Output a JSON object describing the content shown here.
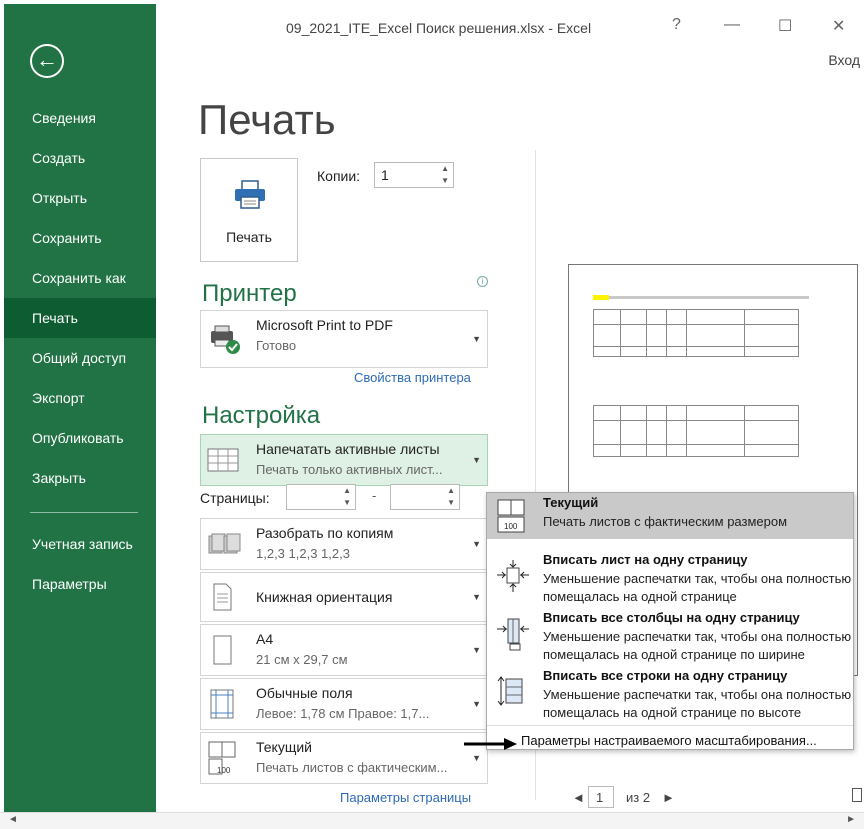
{
  "window": {
    "title": "09_2021_ITE_Excel Поиск решения.xlsx - Excel",
    "help": "?",
    "minimize": "—",
    "maximize": "☐",
    "close": "✕",
    "sign_in": "Вход"
  },
  "nav": {
    "back_icon": "←",
    "items": [
      {
        "label": "Сведения"
      },
      {
        "label": "Создать"
      },
      {
        "label": "Открыть"
      },
      {
        "label": "Сохранить"
      },
      {
        "label": "Сохранить как"
      },
      {
        "label": "Печать",
        "active": true
      },
      {
        "label": "Общий доступ"
      },
      {
        "label": "Экспорт"
      },
      {
        "label": "Опубликовать"
      },
      {
        "label": "Закрыть"
      },
      {
        "label": "Учетная запись"
      },
      {
        "label": "Параметры"
      }
    ]
  },
  "main": {
    "title": "Печать",
    "print_button": "Печать",
    "copies_label": "Копии:",
    "copies_value": "1",
    "printer_heading": "Принтер",
    "printer_name": "Microsoft Print to PDF",
    "printer_status": "Готово",
    "printer_properties": "Свойства принтера",
    "settings_heading": "Настройка",
    "print_what_title": "Напечатать активные листы",
    "print_what_desc": "Печать только активных лист...",
    "pages_label": "Страницы:",
    "pages_dash": "-",
    "collate_title": "Разобрать по копиям",
    "collate_desc": "1,2,3   1,2,3   1,2,3",
    "orientation": "Книжная ориентация",
    "paper_title": "A4",
    "paper_desc": "21 см x 29,7 см",
    "margins_title": "Обычные поля",
    "margins_desc": "Левое: 1,78 см    Правое: 1,7...",
    "scaling_title": "Текущий",
    "scaling_desc": "Печать листов с фактическим...",
    "page_setup_link": "Параметры страницы"
  },
  "preview_nav": {
    "prev": "◄",
    "page": "1",
    "of": "из 2",
    "next": "►"
  },
  "scaling_menu": {
    "options": [
      {
        "title": "Текущий",
        "desc": [
          "Печать листов с фактическим размером"
        ]
      },
      {
        "title": "Вписать лист на одну страницу",
        "desc": [
          "Уменьшение распечатки так, чтобы она полностью",
          "помещалась на одной странице"
        ]
      },
      {
        "title": "Вписать все столбцы на одну страницу",
        "desc": [
          "Уменьшение распечатки так, чтобы она полностью",
          "помещалась на одной странице по ширине"
        ]
      },
      {
        "title": "Вписать все строки на одну страницу",
        "desc": [
          "Уменьшение распечатки так, чтобы она полностью",
          "помещалась на одной странице по высоте"
        ]
      }
    ],
    "custom_link": "Параметры настраиваемого масштабирования...",
    "icon_number": "100"
  },
  "colors": {
    "nav_green": "#217346",
    "nav_active": "#0d5c32",
    "heading_green": "#217346",
    "link_blue": "#2e6bb3"
  }
}
